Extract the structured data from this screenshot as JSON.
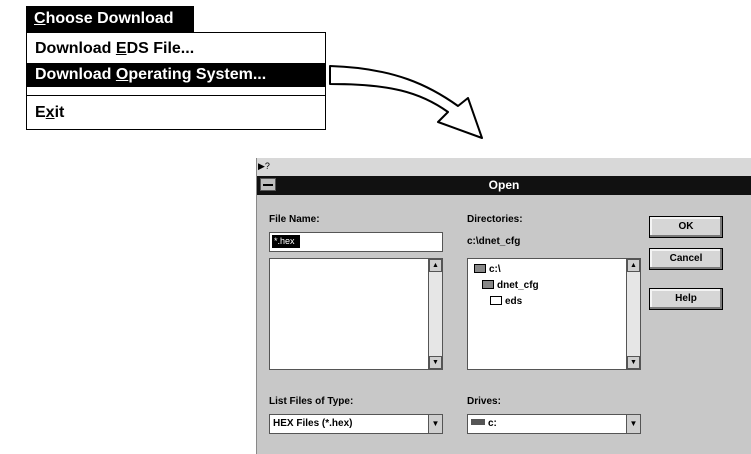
{
  "menu": {
    "title": "Choose Download",
    "items": [
      {
        "pre": "Download ",
        "key": "E",
        "post": "DS File...",
        "selected": false
      },
      {
        "pre": "Download ",
        "key": "O",
        "post": "perating System...",
        "selected": true
      },
      {
        "pre": "E",
        "key": "x",
        "post": "it",
        "selected": false
      }
    ]
  },
  "dialog": {
    "title": "Open",
    "file_name_label": "File Name:",
    "file_name_value": "*.hex",
    "directories_label": "Directories:",
    "current_dir": "c:\\dnet_cfg",
    "dir_items": [
      "c:\\",
      "dnet_cfg",
      "eds"
    ],
    "list_type_label": "List Files of Type:",
    "list_type_value": "HEX Files (*.hex)",
    "drives_label": "Drives:",
    "drive_value": "c:",
    "ok_label": "OK",
    "cancel_label": "Cancel",
    "help_label": "Help"
  },
  "icons": [
    "system-menu-icon",
    "folder-open-icon",
    "folder-icon",
    "drive-icon",
    "scroll-up-icon",
    "scroll-down-icon",
    "dropdown-arrow-icon",
    "curved-arrow-icon"
  ]
}
